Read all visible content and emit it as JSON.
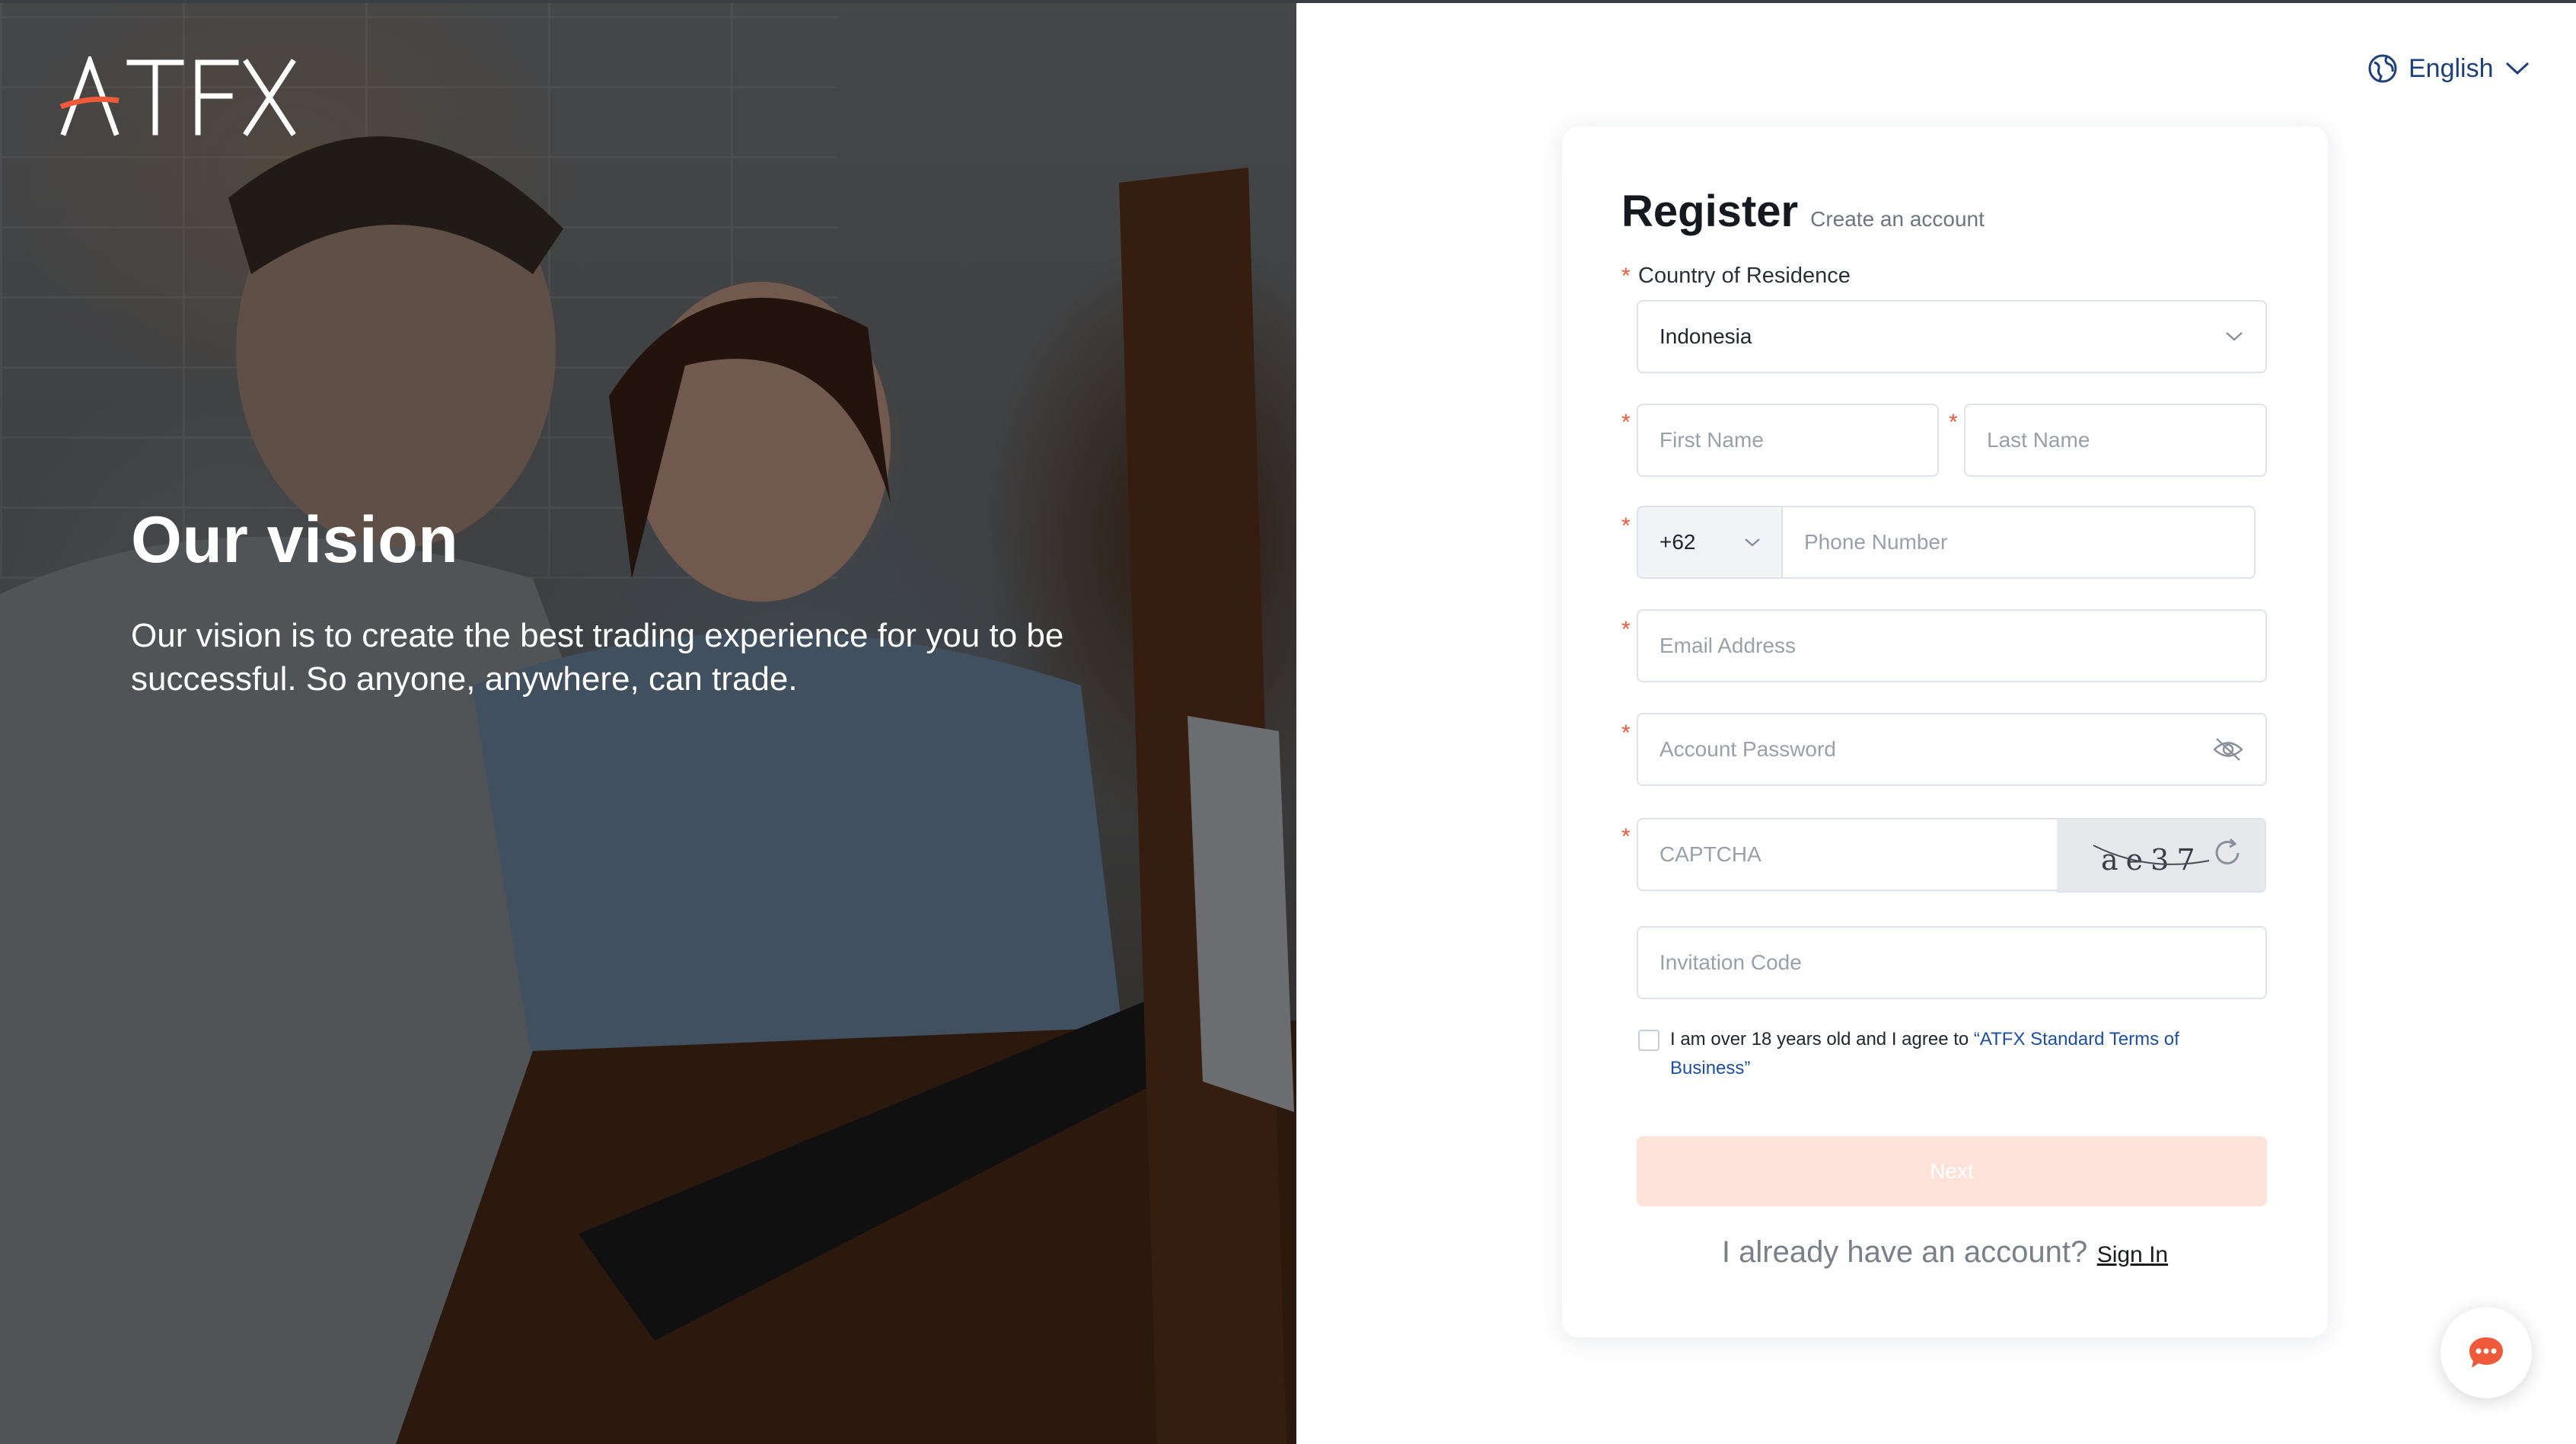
{
  "brand": {
    "logo_text": "ATFX",
    "accent_color": "#ef5b3a"
  },
  "hero": {
    "title": "Our vision",
    "text": "Our vision is to create the best trading experience for you to be successful. So anyone, anywhere, can trade."
  },
  "language": {
    "label": "English",
    "icon": "globe-icon"
  },
  "form": {
    "title": "Register",
    "subtitle": "Create an account",
    "country_label": "Country of Residence",
    "country_value": "Indonesia",
    "first_name_placeholder": "First Name",
    "last_name_placeholder": "Last Name",
    "phone_code": "+62",
    "phone_placeholder": "Phone Number",
    "email_placeholder": "Email Address",
    "password_placeholder": "Account Password",
    "captcha_placeholder": "CAPTCHA",
    "captcha_code": "ae37",
    "invitation_placeholder": "Invitation Code",
    "agree_text": "I am over 18 years old and I agree to ",
    "terms_link": "“ATFX Standard Terms of Business”",
    "next_label": "Next",
    "have_account": "I already have an account?",
    "sign_in": "Sign In",
    "required_mark": "*"
  },
  "chat": {
    "icon": "chat-bubble-icon"
  }
}
